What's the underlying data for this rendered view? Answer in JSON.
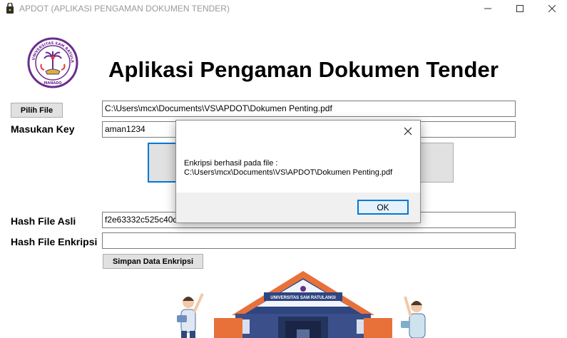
{
  "window": {
    "title": "APDOT (APLIKASI PENGAMAN DOKUMEN TENDER)",
    "minimize_icon": "minimize-icon",
    "maximize_icon": "maximize-icon",
    "close_icon": "close-icon"
  },
  "logo": {
    "text_top": "UNIVERSITAS SAM RATULANGI",
    "text_bottom": "MANADO",
    "color": "#6a2c8e"
  },
  "heading": "Aplikasi Pengaman Dokumen Tender",
  "form": {
    "pick_file_label": "Pilih File",
    "file_path": "C:\\Users\\mcx\\Documents\\VS\\APDOT\\Dokumen Penting.pdf",
    "key_label": "Masukan Key",
    "key_value": "aman1234",
    "hash_original_label": "Hash File Asli",
    "hash_original_value": "f2e63332c525c40d3",
    "hash_encrypted_label": "Hash File Enkripsi",
    "hash_encrypted_value": "",
    "save_button_label": "Simpan Data Enkripsi"
  },
  "illustration": {
    "building_sign": "UNIVERSITAS SAM RATULANGI",
    "roof_color": "#e8713a",
    "wall_color": "#3b4f8a"
  },
  "dialog": {
    "message_line1": "Enkripsi berhasil pada file :",
    "message_line2": "C:\\Users\\mcx\\Documents\\VS\\APDOT\\Dokumen Penting.pdf",
    "ok_label": "OK",
    "close_icon": "close-icon"
  }
}
